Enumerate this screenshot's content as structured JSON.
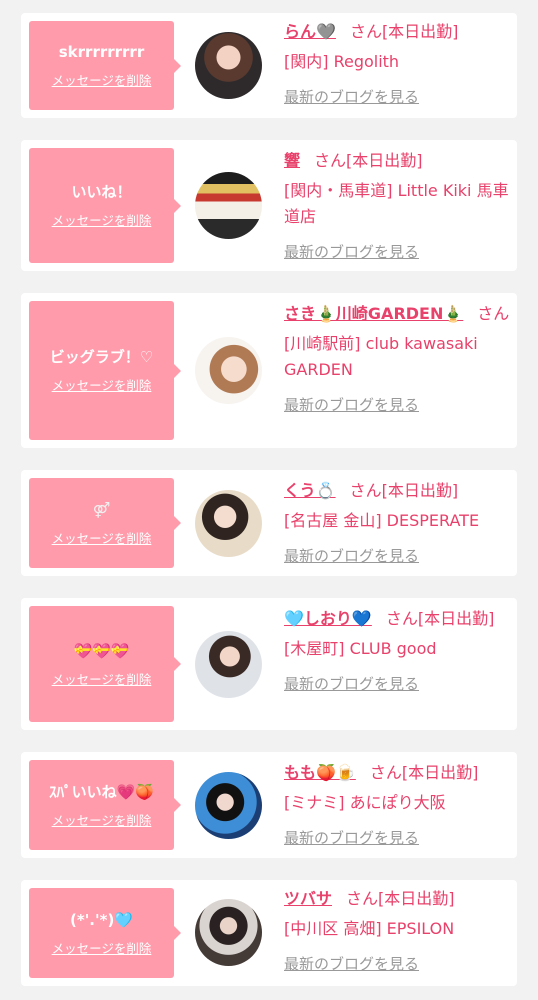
{
  "delete_label": "メッセージを削除",
  "blog_label": "最新のブログを見る",
  "cards": [
    {
      "message": "skrrrrrrrrr",
      "name": "らん🩶",
      "san": "さん[本日出勤]",
      "location": "[関内] Regolith"
    },
    {
      "message": "いいね！",
      "name": "響",
      "san": "さん[本日出勤]",
      "location": "[関内・馬車道] Little Kiki 馬車道店"
    },
    {
      "message": "ビッグラブ！♡",
      "name": "さき🎍川崎GARDEN🎍",
      "san": "さん",
      "location": "[川崎駅前] club kawasaki GARDEN"
    },
    {
      "message": "⚤",
      "name": "くう💍",
      "san": "さん[本日出勤]",
      "location": "[名古屋 金山] DESPERATE"
    },
    {
      "message": "💝💝💝",
      "name": "🩵しおり💙",
      "san": "さん[本日出勤]",
      "location": "[木屋町] CLUB good"
    },
    {
      "message": "ｽﾊﾟいいね💗🍑",
      "name": "もも🍑🍺",
      "san": "さん[本日出勤]",
      "location": "[ミナミ] あにぽり大阪"
    },
    {
      "message": "(*'.'*)🩵",
      "name": "ツバサ",
      "san": "さん[本日出勤]",
      "location": "[中川区 高畑] EPSILON"
    }
  ],
  "colors": {
    "accent": "#e8416b",
    "bubble": "#ff9bab",
    "link_gray": "#999999",
    "background": "#f2f2f2"
  }
}
